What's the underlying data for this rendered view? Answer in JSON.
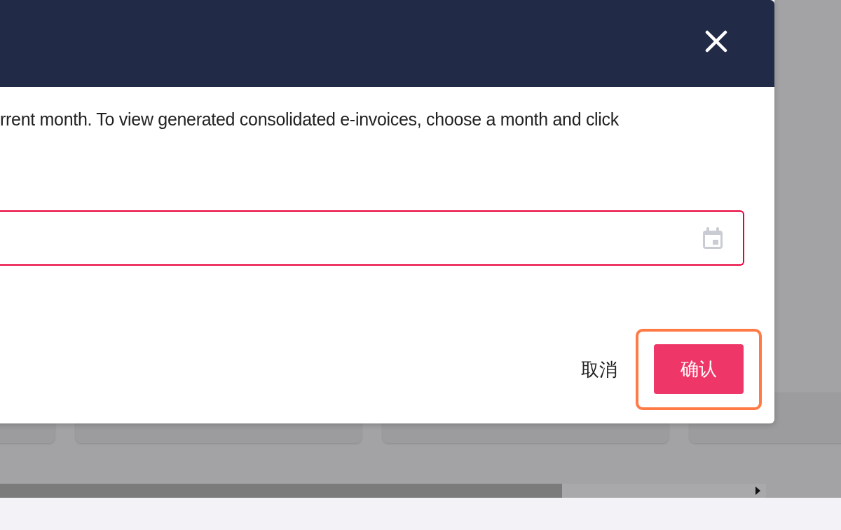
{
  "background_cards": [
    {
      "kind": "card"
    },
    {
      "kind": "card"
    },
    {
      "kind": "card"
    },
    {
      "kind": "card"
    }
  ],
  "dialog": {
    "description": "rrent month. To view generated consolidated e-invoices, choose a month and click",
    "date_field": {
      "invalid": true
    },
    "buttons": [
      {
        "label": "取消",
        "kind": "text"
      },
      {
        "label": "确认",
        "kind": "primary"
      }
    ]
  }
}
